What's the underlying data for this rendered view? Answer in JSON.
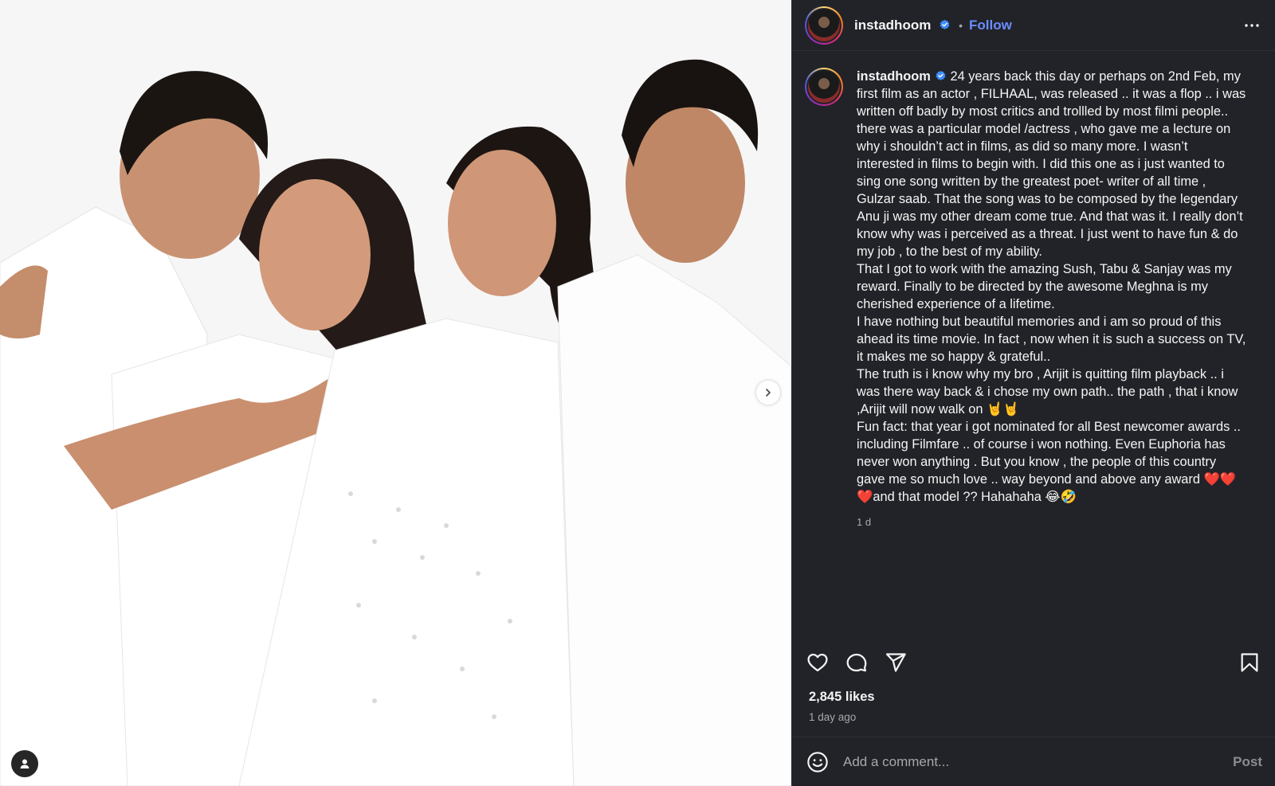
{
  "post": {
    "username": "instadhoom",
    "verified": true,
    "follow_label": "Follow",
    "separator": "•",
    "more_icon": "more-horizontal-icon"
  },
  "media": {
    "description_icon": "photo",
    "carousel_total": 4,
    "carousel_active": 1
  },
  "caption": {
    "username": "instadhoom",
    "paragraphs": [
      "24 years back this day or perhaps on 2nd Feb, my first film as an actor , FILHAAL, was released .. it was a flop .. i was written off badly by most critics and trollled by most filmi people.. there was a particular model /actress , who gave me a lecture on why i shouldn’t act in films, as did so many more. I wasn’t interested in films to begin with. I did this one as i just wanted to sing one song written by the greatest poet- writer of all time , Gulzar saab. That the song was to be composed by the legendary Anu ji was my other dream come true. And that was it. I really don’t know why was i perceived as a threat. I just went to have fun & do my job , to the best of my ability.",
      "That I got to work with the amazing Sush, Tabu & Sanjay was my reward. Finally to be directed by the awesome Meghna is my cherished experience of a lifetime.",
      "I have nothing but beautiful memories and i am so proud of this ahead its time movie. In fact , now when it is such a success on TV, it makes me so happy & grateful..",
      "The truth is i know why my bro , Arijit is quitting film playback .. i was there way back & i chose my own path.. the path , that i know ,Arijit will now walk on 🤘🤘",
      "Fun fact: that year i got nominated for all Best newcomer awards .. including Filmfare .. of course i won nothing. Even Euphoria has never won anything . But you know , the people of this country gave me so much love .. way beyond and above any award ❤️❤️❤️and that model ?? Hahahaha 😂🤣"
    ],
    "time": "1 d"
  },
  "stats": {
    "likes": "2,845 likes",
    "posted": "1 day ago"
  },
  "comment": {
    "placeholder": "Add a comment...",
    "post_label": "Post"
  },
  "colors": {
    "panel_bg": "#212328",
    "link": "#6b8cff",
    "muted": "#a8a8a8",
    "verified": "#3f8cff"
  }
}
